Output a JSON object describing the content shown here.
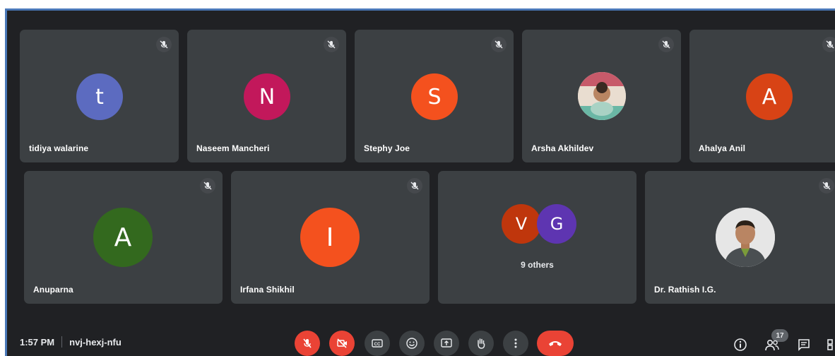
{
  "participants_row1": [
    {
      "name": "tidiya walarine",
      "initial": "t",
      "color": "#5c6bc0"
    },
    {
      "name": "Naseem Mancheri",
      "initial": "N",
      "color": "#c2185b"
    },
    {
      "name": "Stephy Joe",
      "initial": "S",
      "color": "#f4511e"
    },
    {
      "name": "Arsha Akhildev",
      "initial": "",
      "color": ""
    },
    {
      "name": "Ahalya Anil",
      "initial": "A",
      "color": "#d84315"
    }
  ],
  "participants_row2": [
    {
      "name": "Anuparna",
      "initial": "A",
      "color": "#33691e"
    },
    {
      "name": "Irfana Shikhil",
      "initial": "I",
      "color": "#f4511e"
    },
    {
      "name": "Dr. Rathish I.G.",
      "initial": "",
      "color": ""
    }
  ],
  "others_tile": {
    "avatars": [
      {
        "initial": "V",
        "color": "#bf360c"
      },
      {
        "initial": "G",
        "color": "#5e35b1"
      }
    ],
    "label": "9 others"
  },
  "footer": {
    "time": "1:57 PM",
    "meeting_code": "nvj-hexj-nfu",
    "participants_count": "17"
  },
  "controls": [
    {
      "name": "mic-off-button",
      "icon": "mic-off-icon",
      "color": "#ea4335"
    },
    {
      "name": "camera-off-button",
      "icon": "camera-off-icon",
      "color": "#ea4335"
    },
    {
      "name": "captions-button",
      "icon": "cc-icon",
      "color": "#3c4043"
    },
    {
      "name": "reactions-button",
      "icon": "emoji-icon",
      "color": "#3c4043"
    },
    {
      "name": "present-button",
      "icon": "present-icon",
      "color": "#3c4043"
    },
    {
      "name": "raise-hand-button",
      "icon": "hand-icon",
      "color": "#3c4043"
    },
    {
      "name": "more-options-button",
      "icon": "more-vert-icon",
      "color": "#3c4043"
    },
    {
      "name": "leave-call-button",
      "icon": "phone-hangup-icon",
      "color": "#ea4335"
    }
  ]
}
